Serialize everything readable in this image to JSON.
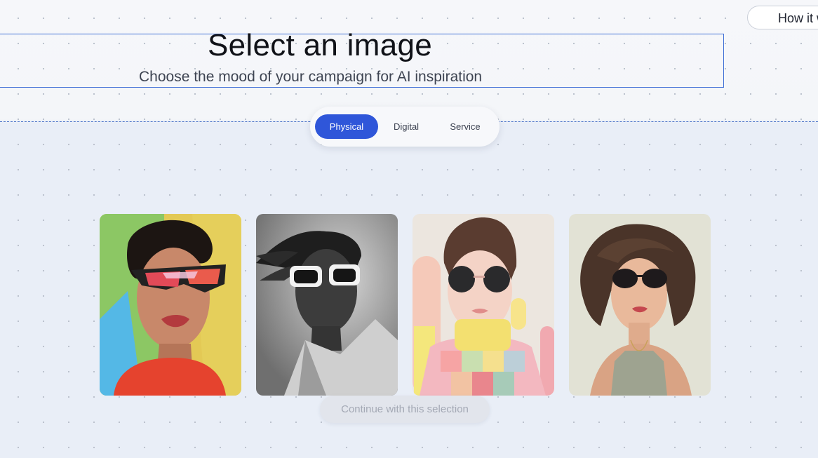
{
  "header": {
    "title": "Select an image",
    "subtitle": "Choose the mood of your campaign for AI inspiration",
    "how_it_works_label": "How it w"
  },
  "tabs": [
    {
      "label": "Physical",
      "active": true
    },
    {
      "label": "Digital",
      "active": false
    },
    {
      "label": "Service",
      "active": false
    }
  ],
  "images": [
    {
      "icon": "woman-red-sunglasses-colorful-image"
    },
    {
      "icon": "woman-white-sunglasses-bw-image"
    },
    {
      "icon": "girl-round-sunglasses-pastel-image"
    },
    {
      "icon": "woman-wavy-hair-sunglasses-illustration"
    }
  ],
  "footer": {
    "continue_label": "Continue with this selection"
  },
  "colors": {
    "accent": "#2f56d9",
    "outline": "#3f6fd6",
    "disabled_bg": "#e2e5ec",
    "disabled_text": "#a4a9b5"
  }
}
